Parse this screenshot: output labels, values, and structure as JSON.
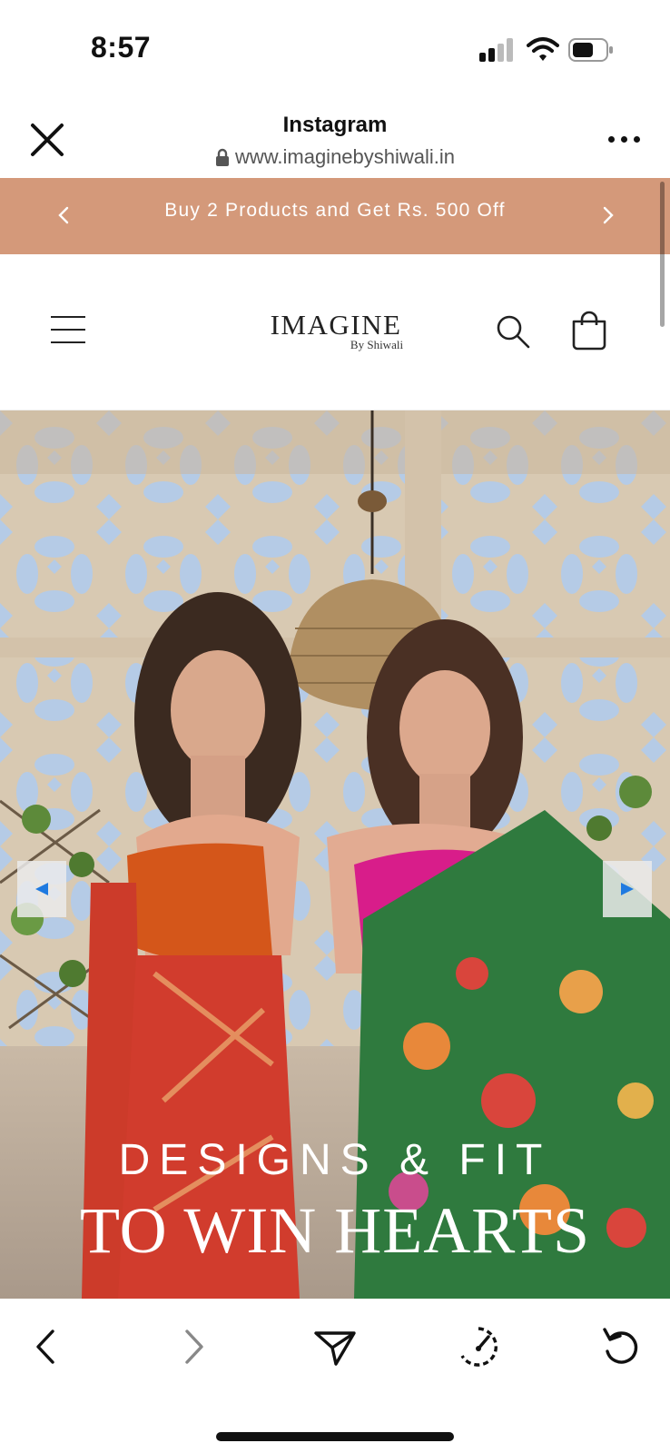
{
  "status_bar": {
    "time": "8:57",
    "icons": [
      "cellular-signal-icon",
      "wifi-icon",
      "battery-icon"
    ]
  },
  "browser": {
    "title": "Instagram",
    "url": "www.imaginebyshiwali.in",
    "icons": [
      "close-icon",
      "lock-icon",
      "more-icon"
    ]
  },
  "announcement": {
    "text": "Buy 2 Products and Get Rs. 500 Off",
    "background": "#D4997A",
    "icons": [
      "chevron-left-icon",
      "chevron-right-icon"
    ]
  },
  "site_header": {
    "logo_main": "IMAGINE",
    "logo_sub": "By Shiwali",
    "icons": [
      "menu-icon",
      "search-icon",
      "cart-icon"
    ]
  },
  "hero": {
    "line1": "DESIGNS & FIT",
    "line2": "TO WIN HEARTS",
    "icons": [
      "play-left-icon",
      "play-right-icon"
    ],
    "accent": "#1f7ae0"
  },
  "toolbar": {
    "icons": [
      "back-icon",
      "forward-icon",
      "share-icon",
      "speed-icon",
      "reload-icon"
    ]
  }
}
